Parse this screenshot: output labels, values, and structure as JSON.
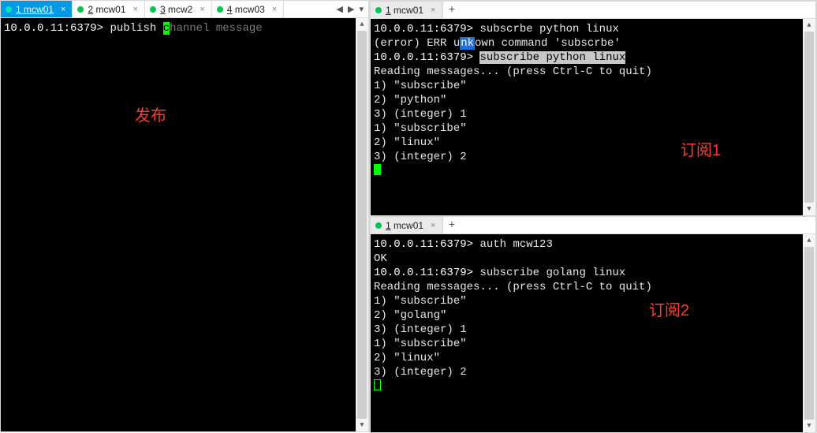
{
  "left": {
    "tabs": [
      {
        "num": "1",
        "label": "mcw01",
        "active": true
      },
      {
        "num": "2",
        "label": "mcw01",
        "active": false
      },
      {
        "num": "3",
        "label": "mcw2",
        "active": false
      },
      {
        "num": "4",
        "label": "mcw03",
        "active": false
      }
    ],
    "prompt": "10.0.0.11:6379>",
    "typed": "publish ",
    "cursor_char": "c",
    "ghost": "hannel message",
    "annotation": "发布"
  },
  "right_top": {
    "tab": {
      "num": "1",
      "label": "mcw01"
    },
    "lines": {
      "l0_prompt": "10.0.0.11:6379>",
      "l0_cmd": "subscrbe python linux",
      "l1a": "(error) ERR u",
      "l1mark": "nk",
      "l1b": "own command 'subscrbe'",
      "l2_prompt": "10.0.0.11:6379>",
      "l2_cmd_sel": "subscribe python linux",
      "l3": "Reading messages... (press Ctrl-C to quit)",
      "l4": "1) \"subscribe\"",
      "l5": "2) \"python\"",
      "l6": "3) (integer) 1",
      "l7": "1) \"subscribe\"",
      "l8": "2) \"linux\"",
      "l9": "3) (integer) 2"
    },
    "annotation": "订阅1"
  },
  "right_bottom": {
    "tab": {
      "num": "1",
      "label": "mcw01"
    },
    "lines": {
      "l0_prompt": "10.0.0.11:6379>",
      "l0_cmd": "auth mcw123",
      "l1": "OK",
      "l2_prompt": "10.0.0.11:6379>",
      "l2_cmd": "subscribe golang linux",
      "l3": "Reading messages... (press Ctrl-C to quit)",
      "l4": "1) \"subscribe\"",
      "l5": "2) \"golang\"",
      "l6": "3) (integer) 1",
      "l7": "1) \"subscribe\"",
      "l8": "2) \"linux\"",
      "l9": "3) (integer) 2"
    },
    "annotation": "订阅2"
  }
}
